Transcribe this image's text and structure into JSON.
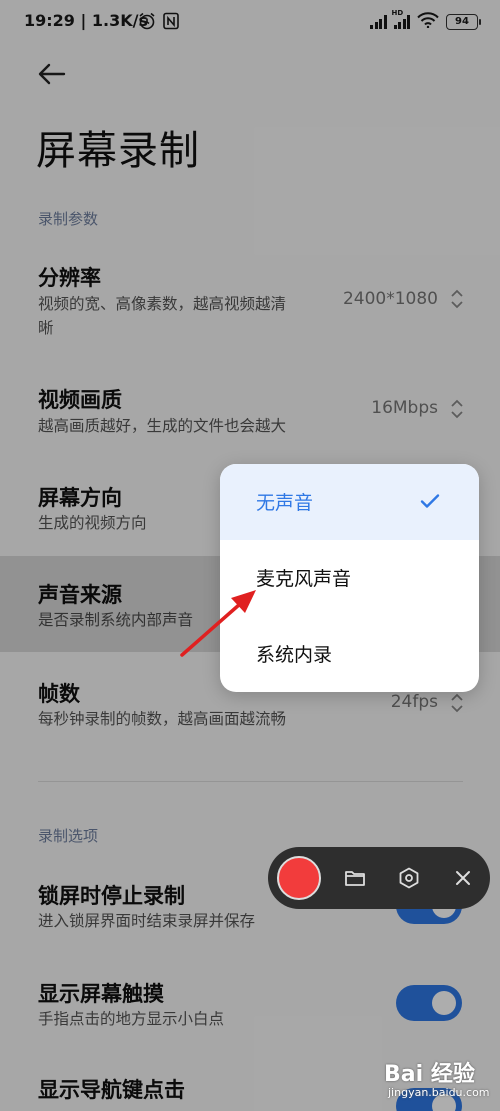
{
  "status_bar": {
    "time_speed": "19:29 | 1.3K/s",
    "signal_label": "HD",
    "battery": "94"
  },
  "page": {
    "title": "屏幕录制"
  },
  "sections": {
    "params_label": "录制参数",
    "options_label": "录制选项"
  },
  "settings": {
    "resolution": {
      "title": "分辨率",
      "subtitle_line1": "视频的宽、高像素数，越高视频越清",
      "subtitle_line2": "晰",
      "value": "2400*1080"
    },
    "quality": {
      "title": "视频画质",
      "subtitle": "越高画质越好，生成的文件也会越大",
      "value": "16Mbps"
    },
    "orientation": {
      "title": "屏幕方向",
      "subtitle": "生成的视频方向"
    },
    "audio_source": {
      "title": "声音来源",
      "subtitle": "是否录制系统内部声音"
    },
    "fps": {
      "title": "帧数",
      "subtitle": "每秒钟录制的帧数，越高画面越流畅",
      "value": "24fps"
    }
  },
  "options": {
    "stop_on_lock": {
      "title": "锁屏时停止录制",
      "subtitle": "进入锁屏界面时结束录屏并保存",
      "enabled": true
    },
    "show_touches": {
      "title": "显示屏幕触摸",
      "subtitle": "手指点击的地方显示小白点",
      "enabled": true
    },
    "show_nav_taps": {
      "title": "显示导航键点击",
      "subtitle": "",
      "enabled": true
    }
  },
  "popup": {
    "options": [
      {
        "label": "无声音",
        "selected": true
      },
      {
        "label": "麦克风声音",
        "selected": false
      },
      {
        "label": "系统内录",
        "selected": false
      }
    ]
  },
  "colors": {
    "accent": "#2f78e5",
    "record": "#f23c3c",
    "annotation_arrow": "#e02020"
  },
  "watermark": {
    "logo": "Bai 经验",
    "url": "jingyan.baidu.com"
  }
}
